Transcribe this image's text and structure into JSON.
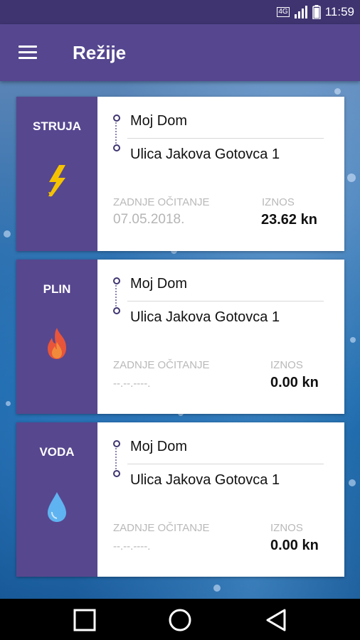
{
  "status": {
    "time": "11:59",
    "network": "4G"
  },
  "header": {
    "title": "Režije"
  },
  "cards": [
    {
      "type": "STRUJA",
      "icon": "lightning-icon",
      "place": "Moj Dom",
      "address": "Ulica Jakova Gotovca 1",
      "last_reading_label": "ZADNJE OČITANJE",
      "last_reading": "07.05.2018.",
      "amount_label": "IZNOS",
      "amount": "23.62 kn"
    },
    {
      "type": "PLIN",
      "icon": "fire-icon",
      "place": "Moj Dom",
      "address": "Ulica Jakova Gotovca 1",
      "last_reading_label": "ZADNJE OČITANJE",
      "last_reading": "--.--.----.",
      "amount_label": "IZNOS",
      "amount": "0.00 kn"
    },
    {
      "type": "VODA",
      "icon": "water-drop-icon",
      "place": "Moj Dom",
      "address": "Ulica Jakova Gotovca 1",
      "last_reading_label": "ZADNJE OČITANJE",
      "last_reading": "--.--.----.",
      "amount_label": "IZNOS",
      "amount": "0.00 kn"
    }
  ],
  "colors": {
    "primary": "#55468f",
    "primary_dark": "#3f3470",
    "lightning": "#f5c200",
    "fire": "#e8553a",
    "water": "#5fb3f0"
  }
}
